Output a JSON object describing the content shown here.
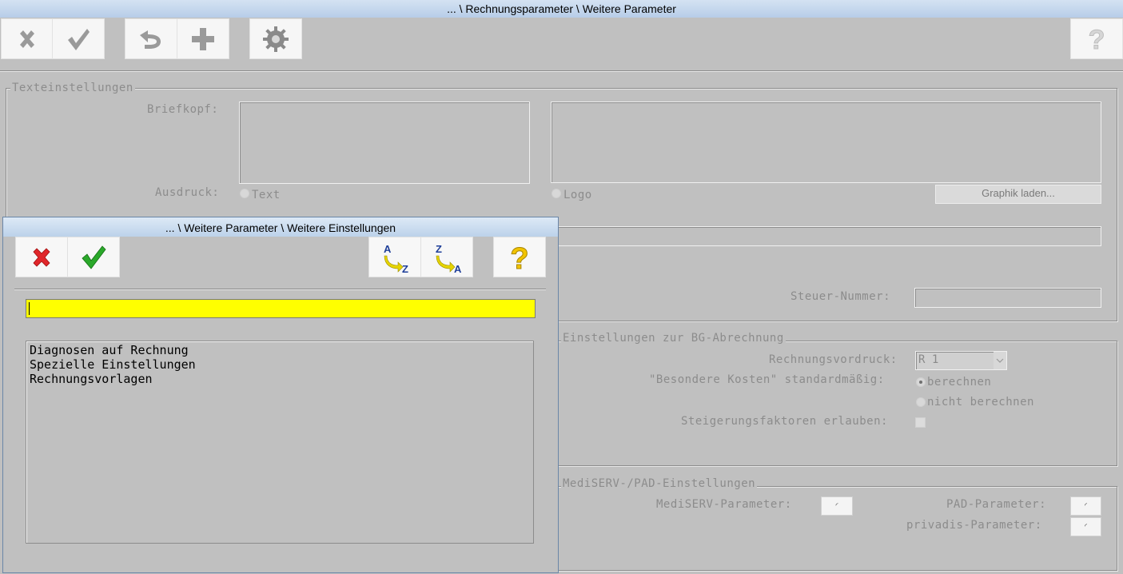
{
  "window": {
    "title": "... \\ Rechnungsparameter \\ Weitere Parameter"
  },
  "toolbar": {
    "buttons": [
      {
        "id": "cancel",
        "icon": "close-icon"
      },
      {
        "id": "confirm",
        "icon": "check-icon"
      },
      {
        "id": "undo",
        "icon": "undo-icon"
      },
      {
        "id": "add",
        "icon": "plus-icon"
      },
      {
        "id": "settings",
        "icon": "gear-icon"
      },
      {
        "id": "help",
        "icon": "help-icon"
      }
    ]
  },
  "text_settings": {
    "legend": "Texteinstellungen",
    "letterhead_label": "Briefkopf:",
    "print_label": "Ausdruck:",
    "radio_text": "Text",
    "radio_logo": "Logo",
    "load_graphic": "Graphik laden..."
  },
  "tax": {
    "label": "Steuer-Nummer:"
  },
  "bg": {
    "legend": "Einstellungen zur BG-Abrechnung",
    "form_label": "Rechnungsvordruck:",
    "form_value": "R 1",
    "costs_label": "\"Besondere Kosten\" standardmäßig:",
    "opt_calc": "berechnen",
    "opt_nocalc": "nicht berechnen",
    "factors_label": "Steigerungsfaktoren erlauben:"
  },
  "mediserv": {
    "legend": "MediSERV-/PAD-Einstellungen",
    "mediserv_label": "MediSERV-Parameter:",
    "pad_label": "PAD-Parameter:",
    "privadis_label": "privadis-Parameter:",
    "btn_glyph": "◜"
  },
  "dialog": {
    "title": "... \\ Weitere Parameter \\ Weitere Einstellungen",
    "search_value": "",
    "sort_az": {
      "top": "A",
      "bottom": "Z"
    },
    "sort_za": {
      "top": "Z",
      "bottom": "A"
    },
    "help_glyph": "?",
    "items": [
      "Diagnosen auf Rechnung",
      "Spezielle Einstellungen",
      "Rechnungsvorlagen"
    ]
  },
  "colors": {
    "search_bg": "#ffff00",
    "cancel": "#e0262a",
    "confirm": "#2aa82a",
    "help": "#f2c400"
  }
}
